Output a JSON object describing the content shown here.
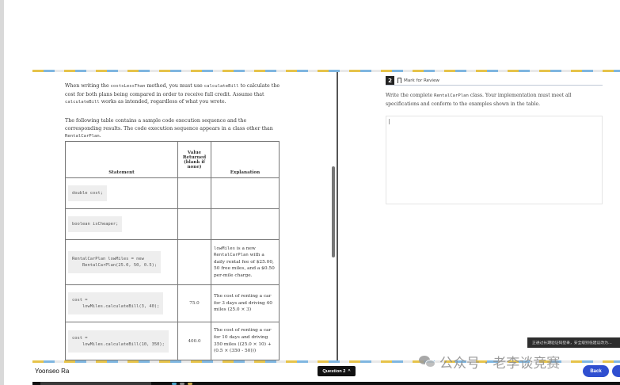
{
  "left": {
    "para1_a": "When writing the ",
    "para1_code1": "costsLessThan",
    "para1_b": " method, you must use ",
    "para1_code2": "calculateBill",
    "para1_c": " to calculate the cost for both plans being compared in order to receive full credit. Assume that ",
    "para1_code3": "calculateBill",
    "para1_d": " works as intended, regardless of what you wrote.",
    "para2_a": "The following table contains a sample code execution sequence and the corresponding results. The code execution sequence appears in a class other than ",
    "para2_code": "RentalCarPlan",
    "para2_b": ".",
    "headers": {
      "statement": "Statement",
      "value": "Value Returned (blank if none)",
      "explanation": "Explanation"
    },
    "rows": [
      {
        "statement": "double cost;",
        "value": "",
        "explanation": ""
      },
      {
        "statement": "boolean isCheaper;",
        "value": "",
        "explanation": ""
      },
      {
        "statement": "RentalCarPlan lowMiles = new\n    RentalCarPlan(25.0, 50, 0.5);",
        "value": "",
        "explanation_code": "lowMiles",
        "explanation_a": " is a new ",
        "explanation_code2": "RentalCarPlan",
        "explanation_b": " with a daily rental fee of $25.00, 50 free miles, and a $0.50 per-mile charge."
      },
      {
        "statement": "cost =\n    lowMiles.calculateBill(3, 40);",
        "value": "75.0",
        "explanation": "The cost of renting a car for 3 days and driving 40 miles (25.0 × 3)"
      },
      {
        "statement": "cost =\n    lowMiles.calculateBill(10, 350);",
        "value": "400.0",
        "explanation": "The cost of renting a car for 10 days and driving 350 miles ((25.0 × 10) + (0.5 × (350 - 50)))"
      }
    ]
  },
  "right": {
    "question_number": "2",
    "mark_for_review": "Mark for Review",
    "prompt_a": "Write the complete ",
    "prompt_code": "RentalCarPlan",
    "prompt_b": " class. Your implementation must meet all specifications and conform to the examples shown in the table."
  },
  "toast": "正通过长期验证码登录，安全级别低建议改为…",
  "watermark": "公众号 · 老李谈竞赛",
  "footer": {
    "user": "Yoonseo Ra",
    "question_nav": "Question 2",
    "back": "Back"
  },
  "colors": {
    "accent": "#2f4fd0",
    "dash_yellow": "#e6c34a",
    "dash_blue": "#7fb6e0"
  }
}
